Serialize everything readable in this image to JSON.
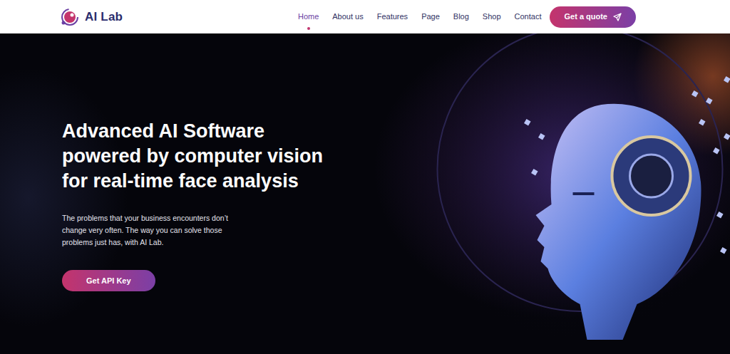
{
  "logo": {
    "text": "AI Lab"
  },
  "nav": {
    "items": [
      {
        "label": "Home",
        "selected": true
      },
      {
        "label": "About us",
        "selected": false
      },
      {
        "label": "Features",
        "selected": false
      },
      {
        "label": "Page",
        "selected": false
      },
      {
        "label": "Blog",
        "selected": false
      },
      {
        "label": "Shop",
        "selected": false
      },
      {
        "label": "Contact",
        "selected": false
      }
    ]
  },
  "quote_button": {
    "label": "Get a quote"
  },
  "hero": {
    "title_lines": [
      "Advanced AI Software",
      "powered by computer vision",
      "for real-time face analysis"
    ],
    "text_lines": [
      "The problems that your business encounters don’t",
      "change very often. The way you can solve those",
      "problems just has, with AI Lab."
    ],
    "button": {
      "label": "Get API Key"
    }
  }
}
